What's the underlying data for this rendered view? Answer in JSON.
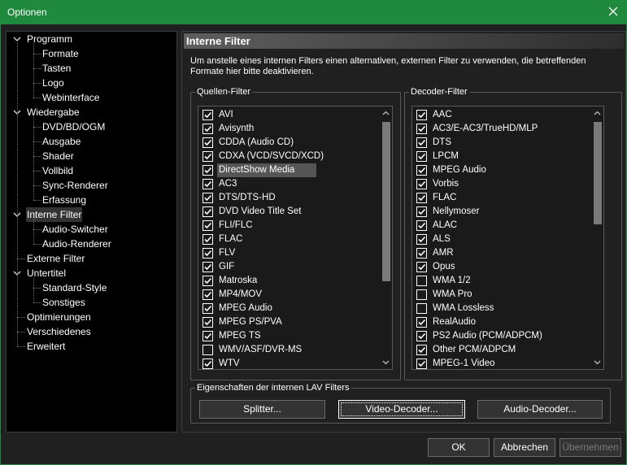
{
  "window": {
    "title": "Optionen"
  },
  "tree": {
    "items": [
      {
        "label": "Programm",
        "level": 0,
        "expanded": true
      },
      {
        "label": "Formate",
        "level": 1
      },
      {
        "label": "Tasten",
        "level": 1
      },
      {
        "label": "Logo",
        "level": 1
      },
      {
        "label": "Webinterface",
        "level": 1
      },
      {
        "label": "Wiedergabe",
        "level": 0,
        "expanded": true
      },
      {
        "label": "DVD/BD/OGM",
        "level": 1
      },
      {
        "label": "Ausgabe",
        "level": 1
      },
      {
        "label": "Shader",
        "level": 1
      },
      {
        "label": "Vollbild",
        "level": 1
      },
      {
        "label": "Sync-Renderer",
        "level": 1
      },
      {
        "label": "Erfassung",
        "level": 1
      },
      {
        "label": "Interne Filter",
        "level": 0,
        "expanded": true,
        "selected": true
      },
      {
        "label": "Audio-Switcher",
        "level": 1
      },
      {
        "label": "Audio-Renderer",
        "level": 1
      },
      {
        "label": "Externe Filter",
        "level": 0
      },
      {
        "label": "Untertitel",
        "level": 0,
        "expanded": true
      },
      {
        "label": "Standard-Style",
        "level": 1
      },
      {
        "label": "Sonstiges",
        "level": 1
      },
      {
        "label": "Optimierungen",
        "level": 0
      },
      {
        "label": "Verschiedenes",
        "level": 0
      },
      {
        "label": "Erweitert",
        "level": 0
      }
    ]
  },
  "panel": {
    "header": "Interne Filter",
    "description": "Um anstelle eines internen Filters einen alternativen, externen Filter zu verwenden, die betreffenden Formate hier bitte deaktivieren."
  },
  "source_filters": {
    "legend": "Quellen-Filter",
    "items": [
      {
        "label": "AVI",
        "checked": true
      },
      {
        "label": "Avisynth",
        "checked": true
      },
      {
        "label": "CDDA (Audio CD)",
        "checked": true
      },
      {
        "label": "CDXA (VCD/SVCD/XCD)",
        "checked": true
      },
      {
        "label": "DirectShow Media",
        "checked": true,
        "highlight": true
      },
      {
        "label": "AC3",
        "checked": true
      },
      {
        "label": "DTS/DTS-HD",
        "checked": true
      },
      {
        "label": "DVD Video Title Set",
        "checked": true
      },
      {
        "label": "FLI/FLC",
        "checked": true
      },
      {
        "label": "FLAC",
        "checked": true
      },
      {
        "label": "FLV",
        "checked": true
      },
      {
        "label": "GIF",
        "checked": true
      },
      {
        "label": "Matroska",
        "checked": true
      },
      {
        "label": "MP4/MOV",
        "checked": true
      },
      {
        "label": "MPEG Audio",
        "checked": true
      },
      {
        "label": "MPEG PS/PVA",
        "checked": true
      },
      {
        "label": "MPEG TS",
        "checked": true
      },
      {
        "label": "WMV/ASF/DVR-MS",
        "checked": false
      },
      {
        "label": "WTV",
        "checked": true
      }
    ]
  },
  "decoder_filters": {
    "legend": "Decoder-Filter",
    "items": [
      {
        "label": "AAC",
        "checked": true
      },
      {
        "label": "AC3/E-AC3/TrueHD/MLP",
        "checked": true
      },
      {
        "label": "DTS",
        "checked": true
      },
      {
        "label": "LPCM",
        "checked": true
      },
      {
        "label": "MPEG Audio",
        "checked": true
      },
      {
        "label": "Vorbis",
        "checked": true
      },
      {
        "label": "FLAC",
        "checked": true
      },
      {
        "label": "Nellymoser",
        "checked": true
      },
      {
        "label": "ALAC",
        "checked": true
      },
      {
        "label": "ALS",
        "checked": true
      },
      {
        "label": "AMR",
        "checked": true
      },
      {
        "label": "Opus",
        "checked": true
      },
      {
        "label": "WMA 1/2",
        "checked": false
      },
      {
        "label": "WMA Pro",
        "checked": false
      },
      {
        "label": "WMA Lossless",
        "checked": false
      },
      {
        "label": "RealAudio",
        "checked": true
      },
      {
        "label": "PS2 Audio (PCM/ADPCM)",
        "checked": true
      },
      {
        "label": "Other PCM/ADPCM",
        "checked": true
      },
      {
        "label": "MPEG-1 Video",
        "checked": true
      }
    ]
  },
  "lav": {
    "legend": "Eigenschaften der internen LAV Filters",
    "splitter_label": "Splitter...",
    "video_label": "Video-Decoder...",
    "audio_label": "Audio-Decoder..."
  },
  "footer": {
    "ok_label": "OK",
    "cancel_label": "Abbrechen",
    "apply_label": "Übernehmen"
  },
  "colors": {
    "accent": "#1f8a3e",
    "background": "#202020",
    "list_background": "#1a1a1a"
  }
}
